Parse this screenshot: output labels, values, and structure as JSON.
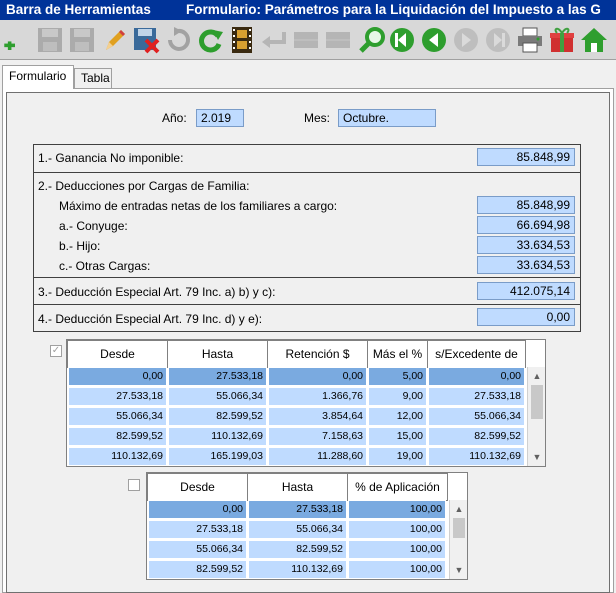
{
  "titlebar": {
    "toolbar_label": "Barra de Herramientas",
    "form_title": "Formulario: Parámetros para la Liquidación del Impuesto a las G"
  },
  "toolbar": {
    "buttons": [
      {
        "name": "add",
        "icon": "plus-icon",
        "enabled": true
      },
      {
        "name": "save",
        "icon": "floppy-icon",
        "enabled": false
      },
      {
        "name": "save-as",
        "icon": "floppy-edit-icon",
        "enabled": false
      },
      {
        "name": "edit",
        "icon": "pencil-icon",
        "enabled": true
      },
      {
        "name": "delete",
        "icon": "delete-floppy-icon",
        "enabled": true
      },
      {
        "name": "undo",
        "icon": "undo-icon",
        "enabled": false
      },
      {
        "name": "refresh",
        "icon": "refresh-icon",
        "enabled": true
      },
      {
        "name": "film",
        "icon": "film-icon",
        "enabled": true
      },
      {
        "name": "back-enter",
        "icon": "enter-arrow-icon",
        "enabled": false
      },
      {
        "name": "grid-1",
        "icon": "grid-icon",
        "enabled": false
      },
      {
        "name": "grid-2",
        "icon": "grid-icon",
        "enabled": false
      },
      {
        "name": "search",
        "icon": "magnifier-icon",
        "enabled": true
      },
      {
        "name": "first",
        "icon": "first-record-icon",
        "enabled": true
      },
      {
        "name": "previous",
        "icon": "previous-record-icon",
        "enabled": true
      },
      {
        "name": "next",
        "icon": "next-record-icon",
        "enabled": false
      },
      {
        "name": "last",
        "icon": "last-record-icon",
        "enabled": false
      },
      {
        "name": "print",
        "icon": "printer-icon",
        "enabled": true
      },
      {
        "name": "gift",
        "icon": "gift-icon",
        "enabled": true
      },
      {
        "name": "home",
        "icon": "home-icon",
        "enabled": true
      }
    ]
  },
  "tabs": [
    {
      "label": "Formulario",
      "active": true
    },
    {
      "label": "Tabla",
      "active": false
    }
  ],
  "header": {
    "year_label": "Año:",
    "year_value": "2.019",
    "month_label": "Mes:",
    "month_value": "Octubre."
  },
  "sections": {
    "ganancia_label": "1.- Ganancia No imponible:",
    "ganancia_value": "85.848,99",
    "deducciones_label": "2.- Deducciones por Cargas de Familia:",
    "maximo_label": "Máximo de entradas netas de los familiares a cargo:",
    "maximo_value": "85.848,99",
    "conyuge_label": "a.- Conyuge:",
    "conyuge_value": "66.694,98",
    "hijo_label": "b.- Hijo:",
    "hijo_value": "33.634,53",
    "otras_label": "c.- Otras Cargas:",
    "otras_value": "33.634,53",
    "especial_abc_label": "3.- Deducción Especial Art. 79 Inc. a) b) y c):",
    "especial_abc_value": "412.075,14",
    "especial_de_label": "4.- Deducción Especial Art. 79 Inc. d) y e):",
    "especial_de_value": "0,00"
  },
  "scale_table": {
    "checkbox_checked": true,
    "headers": [
      "Desde",
      "Hasta",
      "Retención $",
      "Más el %",
      "s/Excedente de"
    ],
    "rows": [
      [
        "0,00",
        "27.533,18",
        "0,00",
        "5,00",
        "0,00"
      ],
      [
        "27.533,18",
        "55.066,34",
        "1.366,76",
        "9,00",
        "27.533,18"
      ],
      [
        "55.066,34",
        "82.599,52",
        "3.854,64",
        "12,00",
        "55.066,34"
      ],
      [
        "82.599,52",
        "110.132,69",
        "7.158,63",
        "15,00",
        "82.599,52"
      ],
      [
        "110.132,69",
        "165.199,03",
        "11.288,60",
        "19,00",
        "110.132,69"
      ]
    ]
  },
  "apply_table": {
    "checkbox_checked": false,
    "headers": [
      "Desde",
      "Hasta",
      "% de Aplicación"
    ],
    "rows": [
      [
        "0,00",
        "27.533,18",
        "100,00"
      ],
      [
        "27.533,18",
        "55.066,34",
        "100,00"
      ],
      [
        "55.066,34",
        "82.599,52",
        "100,00"
      ],
      [
        "82.599,52",
        "110.132,69",
        "100,00"
      ]
    ]
  },
  "colors": {
    "titlebar": "#003399",
    "field_bg": "#bfdbff",
    "selected_row": "#7aaae0"
  }
}
